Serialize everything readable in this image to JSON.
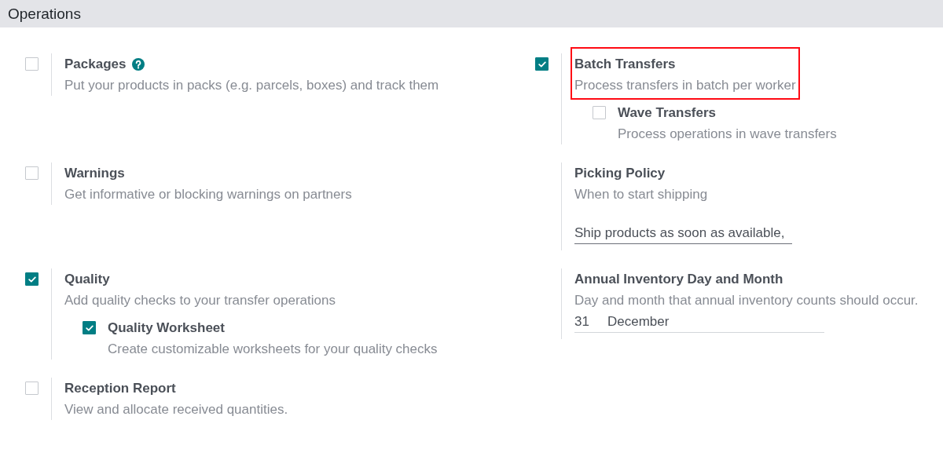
{
  "header": {
    "title": "Operations"
  },
  "settings": [
    {
      "kind": "checkbox",
      "title": "Packages",
      "help": true,
      "highlighted": false,
      "checked": false,
      "description": "Put your products in packs (e.g. parcels, boxes) and track them"
    },
    {
      "kind": "checkbox",
      "title": "Batch Transfers",
      "help": false,
      "highlighted": true,
      "checked": true,
      "description": "Process transfers in batch per worker",
      "children": [
        {
          "title": "Wave Transfers",
          "checked": false,
          "description": "Process operations in wave transfers"
        }
      ]
    },
    {
      "kind": "checkbox",
      "title": "Warnings",
      "help": false,
      "highlighted": false,
      "checked": false,
      "description": "Get informative or blocking warnings on partners"
    },
    {
      "kind": "field",
      "title": "Picking Policy",
      "help": false,
      "highlighted": false,
      "description": "When to start shipping",
      "fields": [
        {
          "kind": "select",
          "value": "Ship products as soon as available,",
          "focused": true
        }
      ]
    },
    {
      "kind": "checkbox",
      "title": "Quality",
      "help": false,
      "highlighted": false,
      "checked": true,
      "description": "Add quality checks to your transfer operations",
      "children": [
        {
          "title": "Quality Worksheet",
          "checked": true,
          "description": "Create customizable worksheets for your quality checks"
        }
      ]
    },
    {
      "kind": "field",
      "title": "Annual Inventory Day and Month",
      "help": false,
      "highlighted": false,
      "description": "Day and month that annual inventory counts should occur.",
      "fields": [
        {
          "kind": "number",
          "value": "31",
          "focused": false
        },
        {
          "kind": "select",
          "value": "December",
          "focused": false
        }
      ]
    },
    {
      "kind": "checkbox",
      "title": "Reception Report",
      "help": false,
      "highlighted": false,
      "checked": false,
      "description": "View and allocate received quantities."
    }
  ]
}
